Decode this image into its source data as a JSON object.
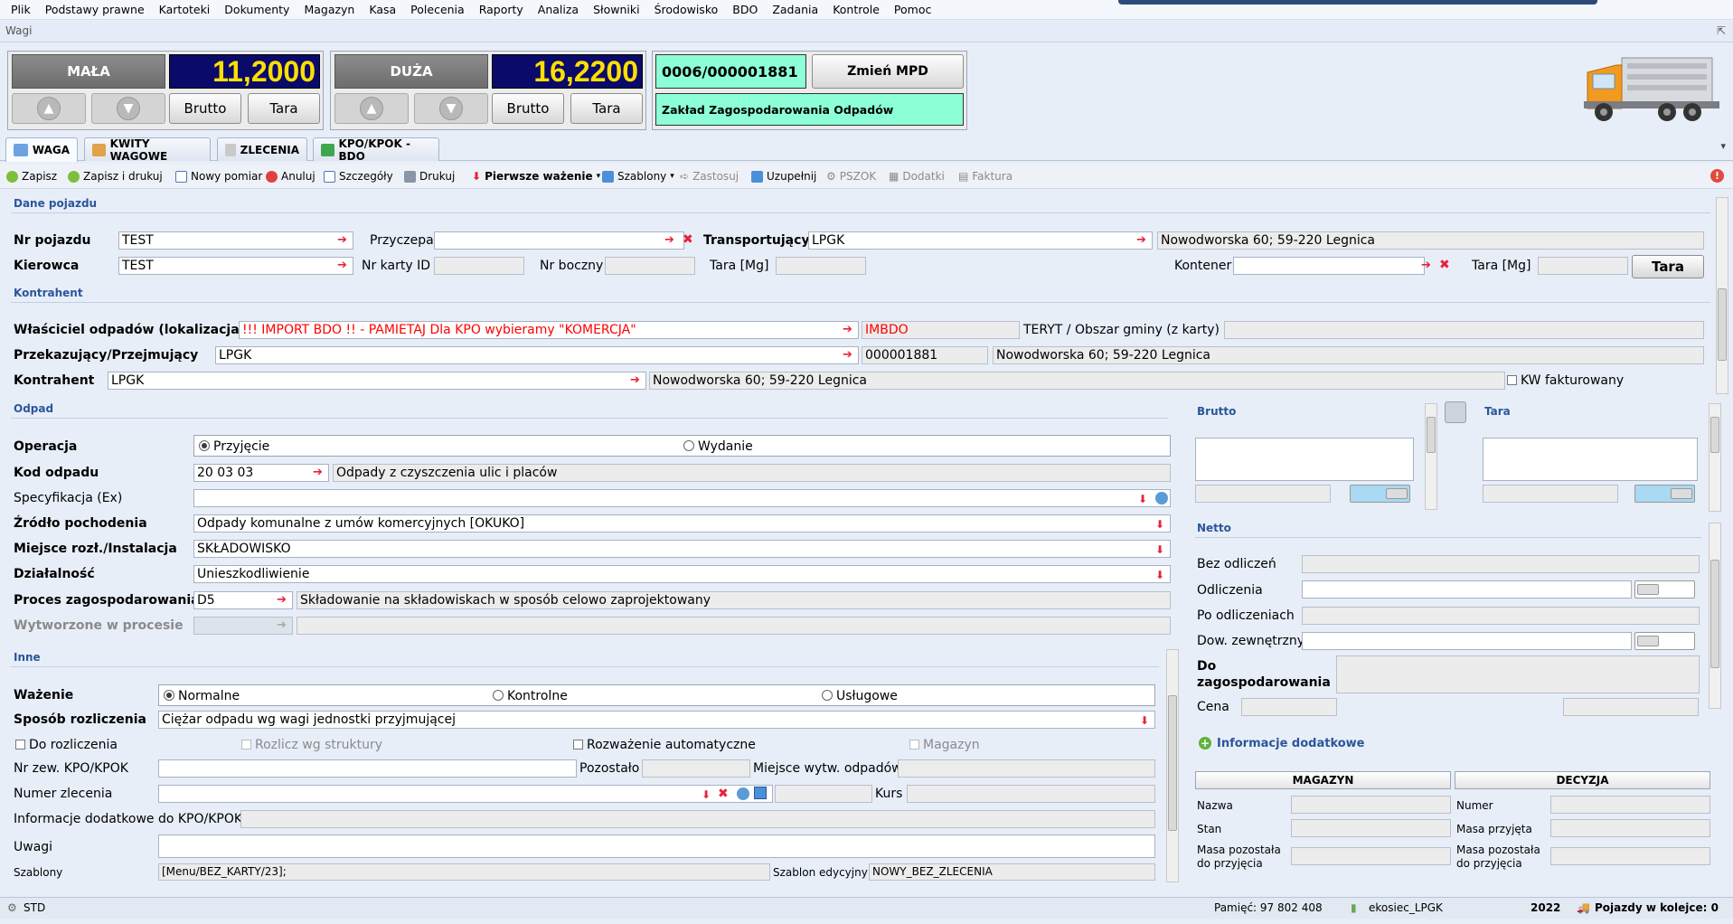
{
  "menu": [
    "Plik",
    "Podstawy prawne",
    "Kartoteki",
    "Dokumenty",
    "Magazyn",
    "Kasa",
    "Polecenia",
    "Raporty",
    "Analiza",
    "Słowniki",
    "Środowisko",
    "BDO",
    "Zadania",
    "Kontrole",
    "Pomoc"
  ],
  "window_title": "Wagi",
  "scales": {
    "small": {
      "label": "MAŁA",
      "value": "11,2000",
      "brutto": "Brutto",
      "tara": "Tara"
    },
    "big": {
      "label": "DUŻA",
      "value": "16,2200",
      "brutto": "Brutto",
      "tara": "Tara"
    }
  },
  "mpd": {
    "code": "0006/000001881",
    "change_button": "Zmień MPD",
    "name": "Zakład Zagospodarowania Odpadów"
  },
  "tabs": [
    "WAGA",
    "KWITY WAGOWE",
    "ZLECENIA",
    "KPO/KPOK - BDO"
  ],
  "toolbar": {
    "save": "Zapisz",
    "save_print": "Zapisz i drukuj",
    "new": "Nowy pomiar",
    "cancel": "Anuluj",
    "details": "Szczegóły",
    "print": "Drukuj",
    "first_weigh": "Pierwsze ważenie",
    "templates": "Szablony",
    "apply": "Zastosuj",
    "fill": "Uzupełnij",
    "pszok": "PSZOK",
    "extras": "Dodatki",
    "invoice": "Faktura"
  },
  "vehicle": {
    "section": "Dane pojazdu",
    "nr_label": "Nr pojazdu",
    "nr_value": "TEST",
    "trailer_label": "Przyczepa",
    "trailer_value": "",
    "carrier_label": "Transportujący",
    "carrier_value": "LPGK",
    "carrier_addr": "Nowodworska 60; 59-220 Legnica",
    "driver_label": "Kierowca",
    "driver_value": "TEST",
    "card_label": "Nr karty ID",
    "side_label": "Nr boczny",
    "tare_label": "Tara [Mg]",
    "container_label": "Kontener",
    "container_tare_label": "Tara [Mg]",
    "tara_button": "Tara"
  },
  "contractor": {
    "section": "Kontrahent",
    "owner_label": "Właściciel odpadów (lokalizacja)",
    "owner_value": "!!! IMPORT BDO !! - PAMIETAJ Dla KPO wybieramy \"KOMERCJA\"",
    "owner_code": "IMBDO",
    "teryt_label": "TERYT / Obszar gminy (z karty)",
    "transfer_label": "Przekazujący/Przejmujący",
    "transfer_value": "LPGK",
    "transfer_code": "000001881",
    "transfer_addr": "Nowodworska 60; 59-220 Legnica",
    "contractor_label": "Kontrahent",
    "contractor_value": "LPGK",
    "contractor_addr": "Nowodworska 60; 59-220 Legnica",
    "kw_label": "KW fakturowany"
  },
  "waste": {
    "section": "Odpad",
    "op_label": "Operacja",
    "op_in": "Przyjęcie",
    "op_out": "Wydanie",
    "code_label": "Kod odpadu",
    "code_value": "20 03 03",
    "code_desc": "Odpady z czyszczenia ulic i placów",
    "spec_label": "Specyfikacja (Ex)",
    "source_label": "Źródło pochodenia",
    "source_value": "Odpady komunalne z umów komercyjnych [OKUKO]",
    "place_label": "Miejsce rozł./Instalacja",
    "place_value": "SKŁADOWISKO",
    "activity_label": "Działalność",
    "activity_value": "Unieszkodliwienie",
    "process_label": "Proces zagospodarowania",
    "process_value": "D5",
    "process_desc": "Składowanie na składowiskach w sposób celowo zaprojektowany",
    "produced_label": "Wytworzone w procesie"
  },
  "other": {
    "section": "Inne",
    "weigh_label": "Ważenie",
    "w_normal": "Normalne",
    "w_control": "Kontrolne",
    "w_service": "Usługowe",
    "settle_label": "Sposób rozliczenia",
    "settle_value": "Ciężar odpadu wg wagi jednostki przyjmującej",
    "to_settle": "Do rozliczenia",
    "by_struct": "Rozlicz wg struktury",
    "auto_weigh": "Rozważenie automatyczne",
    "warehouse": "Magazyn",
    "ext_kpo_label": "Nr zew. KPO/KPOK",
    "remaining_label": "Pozostało",
    "place_prod_label": "Miejsce wytw. odpadów",
    "order_label": "Numer zlecenia",
    "rate_label": "Kurs",
    "kpo_info_label": "Informacje dodatkowe do KPO/KPOK",
    "notes_label": "Uwagi",
    "templates_label": "Szablony",
    "templates_value": "[Menu/BEZ_KARTY/23];",
    "edit_template_label": "Szablon edycyjny",
    "edit_template_value": "NOWY_BEZ_ZLECENIA"
  },
  "weights": {
    "brutto": "Brutto",
    "tara": "Tara"
  },
  "netto": {
    "section": "Netto",
    "no_deduct": "Bez odliczeń",
    "deduct": "Odliczenia",
    "after_deduct": "Po odliczeniach",
    "external_doc": "Dow. zewnętrzny",
    "to_manage": "Do zagospodarowania",
    "price": "Cena"
  },
  "extra_info": "Informacje dodatkowe",
  "magazyn": {
    "header": "MAGAZYN",
    "name": "Nazwa",
    "state": "Stan",
    "remaining": "Masa pozostała do przyjęcia"
  },
  "decyzja": {
    "header": "DECYZJA",
    "number": "Numer",
    "accepted": "Masa przyjęta",
    "remaining": "Masa pozostała do przyjęcia"
  },
  "status": {
    "mode": "STD",
    "memory": "Pamięć: 97 802 408",
    "db": "ekosiec_LPGK",
    "year": "2022",
    "queue": "Pojazdy w kolejce: 0"
  },
  "colors": {
    "accent": "#2a5699",
    "display_bg": "#0a0a6a",
    "display_fg": "#ffdf00",
    "mpd_bg": "#8dffd6",
    "required_red": "#e8203a"
  }
}
